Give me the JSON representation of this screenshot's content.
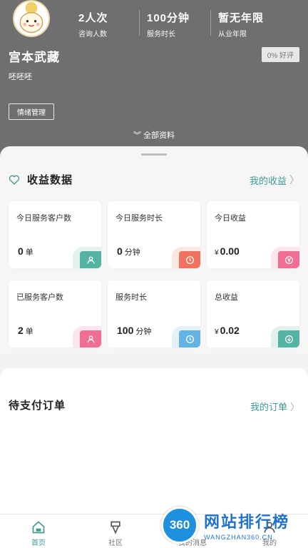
{
  "header": {
    "stats": [
      {
        "value": "2人次",
        "label": "咨询人数"
      },
      {
        "value": "100分钟",
        "label": "服务时长"
      },
      {
        "value": "暂无年限",
        "label": "从业年限"
      }
    ],
    "name": "宫本武藏",
    "rating": "0% 好评",
    "motto": "呸呸呸",
    "mood_button": "情绪管理",
    "more": "全部资料"
  },
  "income": {
    "title": "收益数据",
    "link": "我的收益",
    "cards": [
      {
        "title": "今日服务客户数",
        "value": "0",
        "unit": "单",
        "currency": "",
        "icon": "person-icon",
        "color": "#55b3a3"
      },
      {
        "title": "今日服务时长",
        "value": "0",
        "unit": "分钟",
        "currency": "",
        "icon": "clock-icon",
        "color": "#ef7360"
      },
      {
        "title": "今日收益",
        "value": "0.00",
        "unit": "",
        "currency": "¥",
        "icon": "yen-icon",
        "color": "#ef6e91"
      },
      {
        "title": "已服务客户数",
        "value": "2",
        "unit": "单",
        "currency": "",
        "icon": "person-icon",
        "color": "#ef6e91"
      },
      {
        "title": "服务时长",
        "value": "100",
        "unit": "分钟",
        "currency": "",
        "icon": "clock-icon",
        "color": "#63b3e7"
      },
      {
        "title": "总收益",
        "value": "0.02",
        "unit": "",
        "currency": "¥",
        "icon": "download-icon",
        "color": "#55b3a3"
      }
    ]
  },
  "orders": {
    "title": "待支付订单",
    "link": "我的订单"
  },
  "tabbar": [
    {
      "label": "首页",
      "icon": "home-icon"
    },
    {
      "label": "社区",
      "icon": "community-icon"
    },
    {
      "label": "我的消息",
      "icon": "bell-icon"
    },
    {
      "label": "我的",
      "icon": "user-icon"
    }
  ],
  "watermark": {
    "logo": "360",
    "name": "网站排行榜",
    "domain": "WANGZHAN360.CN"
  },
  "colors": {
    "accent": "#3f9a92",
    "header": "#6f6f6f"
  }
}
